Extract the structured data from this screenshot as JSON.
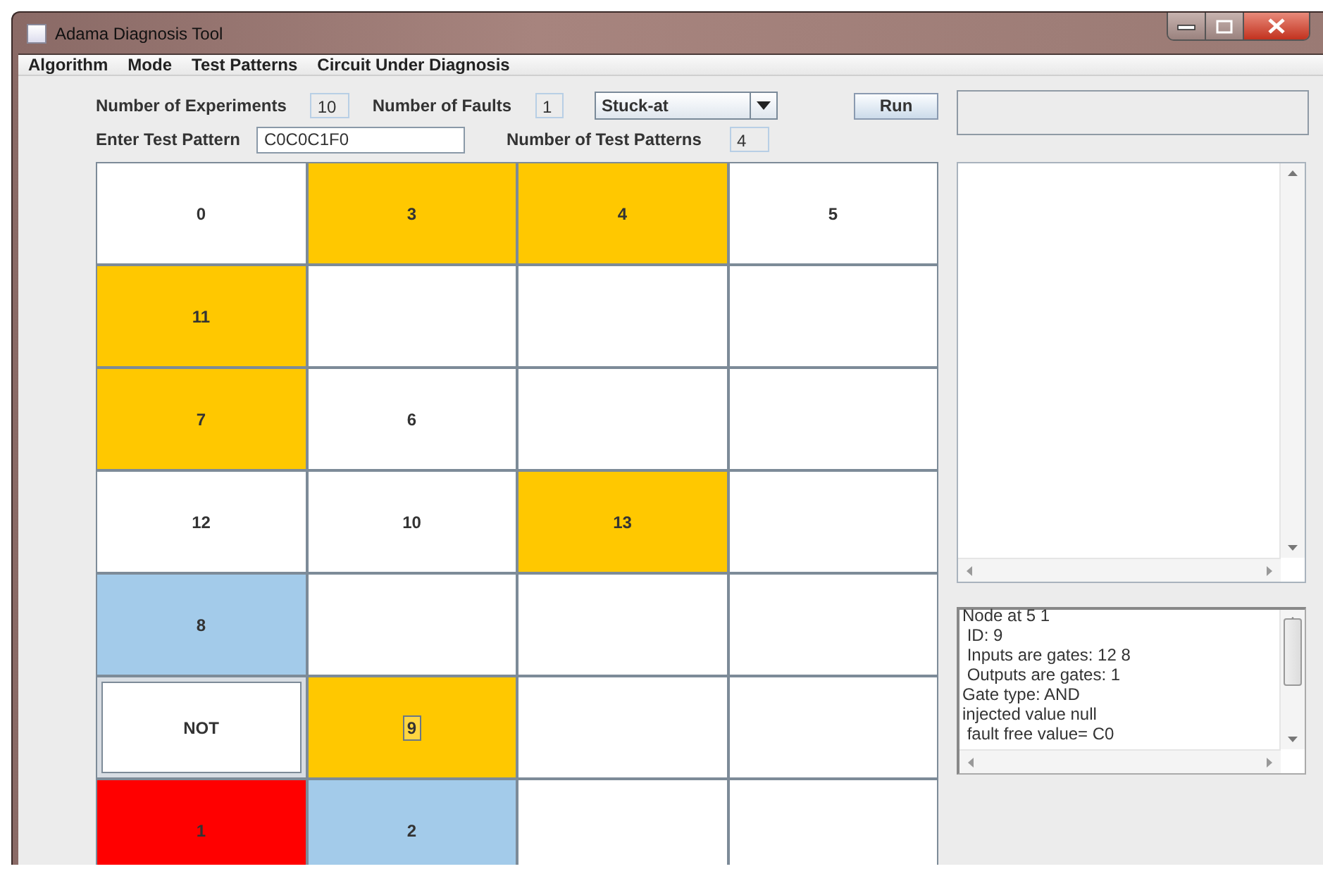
{
  "window": {
    "title": "Adama Diagnosis Tool"
  },
  "menu": [
    "Algorithm",
    "Mode",
    "Test Patterns",
    "Circuit Under Diagnosis"
  ],
  "controls": {
    "experiments_label": "Number of Experiments",
    "experiments": "10",
    "faults_label": "Number of Faults",
    "faults": "1",
    "fault_model": "Stuck-at",
    "run": "Run",
    "pattern_label": "Enter Test Pattern",
    "pattern": "C0C0C1F0",
    "patterns_count_label": "Number of Test Patterns",
    "patterns_count": "4"
  },
  "grid": [
    {
      "label": "0",
      "color": "#ffffff",
      "selected": false,
      "focused": false
    },
    {
      "label": "3",
      "color": "#ffc800",
      "selected": false,
      "focused": false
    },
    {
      "label": "4",
      "color": "#ffc800",
      "selected": false,
      "focused": false
    },
    {
      "label": "5",
      "color": "#ffffff",
      "selected": false,
      "focused": false
    },
    {
      "label": "11",
      "color": "#ffc800",
      "selected": false,
      "focused": false
    },
    {
      "color": "#ffffff",
      "selected": false,
      "focused": false
    },
    {
      "color": "#ffffff",
      "selected": false,
      "focused": false
    },
    {
      "color": "#ffffff",
      "selected": false,
      "focused": false
    },
    {
      "label": "7",
      "color": "#ffc800",
      "selected": false,
      "focused": false
    },
    {
      "label": "6",
      "color": "#ffffff",
      "selected": false,
      "focused": false
    },
    {
      "color": "#ffffff",
      "selected": false,
      "focused": false
    },
    {
      "color": "#ffffff",
      "selected": false,
      "focused": false
    },
    {
      "label": "12",
      "color": "#ffffff",
      "selected": false,
      "focused": false
    },
    {
      "label": "10",
      "color": "#ffffff",
      "selected": false,
      "focused": false
    },
    {
      "label": "13",
      "color": "#ffc800",
      "selected": false,
      "focused": false
    },
    {
      "color": "#ffffff",
      "selected": false,
      "focused": false
    },
    {
      "label": "8",
      "color": "#a3cbea",
      "selected": false,
      "focused": false
    },
    {
      "color": "#ffffff",
      "selected": false,
      "focused": false
    },
    {
      "color": "#ffffff",
      "selected": false,
      "focused": false
    },
    {
      "color": "#ffffff",
      "selected": false,
      "focused": false
    },
    {
      "label": "NOT",
      "color": "#ffffff",
      "selected": true,
      "focused": false
    },
    {
      "label": "9",
      "color": "#ffc800",
      "selected": false,
      "focused": true
    },
    {
      "color": "#ffffff",
      "selected": false,
      "focused": false
    },
    {
      "color": "#ffffff",
      "selected": false,
      "focused": false
    },
    {
      "label": "1",
      "color": "#ff0000",
      "selected": false,
      "focused": false
    },
    {
      "label": "2",
      "color": "#a3cbea",
      "selected": false,
      "focused": false
    },
    {
      "color": "#ffffff",
      "selected": false,
      "focused": false
    },
    {
      "color": "#ffffff",
      "selected": false,
      "focused": false
    }
  ],
  "details": [
    "Node at 5 1",
    " ID: 9",
    " Inputs are gates: 12 8",
    " Outputs are gates: 1",
    "Gate type: AND",
    "injected value null",
    " fault free value= C0"
  ]
}
